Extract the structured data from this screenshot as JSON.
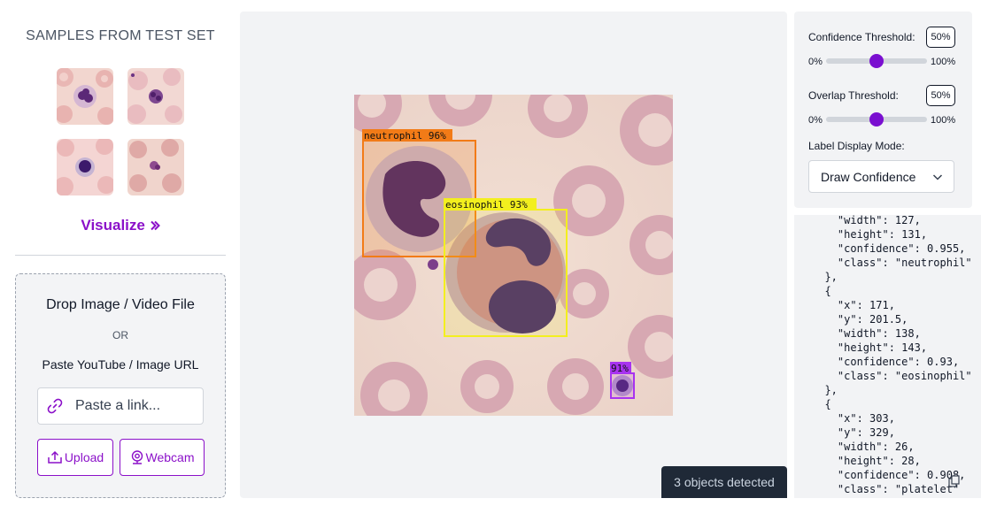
{
  "samples": {
    "title": "SAMPLES FROM TEST SET",
    "visualize_label": "Visualize",
    "visualize_icon": "chevron-double-right-icon"
  },
  "upload": {
    "drop_title": "Drop Image / Video File",
    "or_label": "OR",
    "paste_label": "Paste YouTube / Image URL",
    "link_placeholder": "Paste a link...",
    "upload_label": "Upload",
    "webcam_label": "Webcam"
  },
  "detections": [
    {
      "class": "neutrophil",
      "label": "neutrophil 96%",
      "color": "#f27b17"
    },
    {
      "class": "eosinophil",
      "label": "eosinophil 93%",
      "color": "#f3ef1e"
    },
    {
      "class": "platelet",
      "label": "91%",
      "color": "#a833f0"
    }
  ],
  "status": {
    "objects_detected": "3 objects detected"
  },
  "controls": {
    "confidence_label": "Confidence Threshold:",
    "confidence_value": "50%",
    "overlap_label": "Overlap Threshold:",
    "overlap_value": "50%",
    "range_min": "0%",
    "range_max": "100%",
    "confidence_level": 0.5,
    "overlap_level": 0.5,
    "label_mode_label": "Label Display Mode:",
    "label_mode_value": "Draw Confidence"
  },
  "json_output": "    \"width\": 127,\n    \"height\": 131,\n    \"confidence\": 0.955,\n    \"class\": \"neutrophil\"\n  },\n  {\n    \"x\": 171,\n    \"y\": 201.5,\n    \"width\": 138,\n    \"height\": 143,\n    \"confidence\": 0.93,\n    \"class\": \"eosinophil\"\n  },\n  {\n    \"x\": 303,\n    \"y\": 329,\n    \"width\": 26,\n    \"height\": 28,\n    \"confidence\": 0.908,\n    \"class\": \"platelet\"",
  "colors": {
    "accent": "#8b10c9",
    "slider": "#7a0fd0",
    "badge_bg": "#1f2937"
  }
}
